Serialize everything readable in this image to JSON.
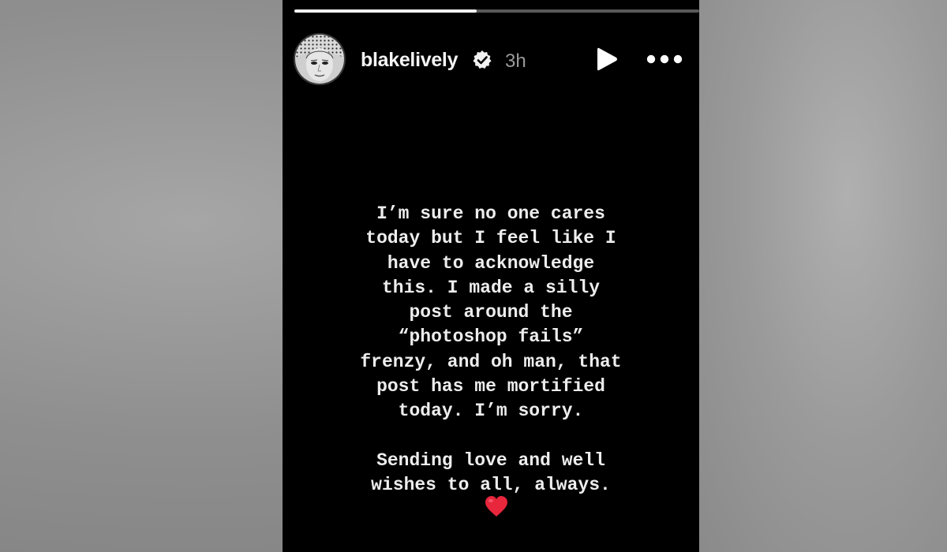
{
  "story": {
    "progress": 0.45,
    "username": "blakelively",
    "timestamp": "3h",
    "verified": true,
    "icons": {
      "verified": "verified-badge-icon",
      "play": "play-icon",
      "more": "more-options-icon",
      "heart": "red-heart-icon"
    },
    "text_lines": [
      "I’m sure no one cares",
      "today but I feel like I",
      "have to acknowledge",
      "this. I made a silly",
      "post around the",
      "“photoshop fails”",
      "frenzy, and oh man, that",
      "post has me mortified",
      "today. I’m sorry."
    ],
    "closing_lines": [
      "Sending love and well",
      "wishes to all, always."
    ],
    "colors": {
      "background": "#000000",
      "text": "#ededed",
      "heart": "#e8263c"
    }
  }
}
